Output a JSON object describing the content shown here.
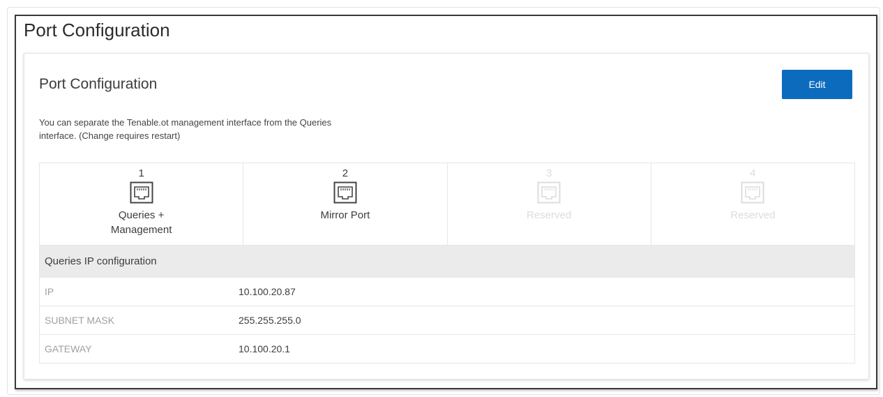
{
  "page": {
    "title": "Port Configuration"
  },
  "card": {
    "title": "Port Configuration",
    "edit_label": "Edit",
    "description_line1": "You can separate the Tenable.ot management interface from the Queries",
    "description_line2": "interface. (Change requires restart)"
  },
  "ports": [
    {
      "number": "1",
      "label_line1": "Queries +",
      "label_line2": "Management",
      "icon": "ethernet-port-icon",
      "enabled": true
    },
    {
      "number": "2",
      "label_line1": "Mirror Port",
      "label_line2": "",
      "icon": "ethernet-port-icon",
      "enabled": true
    },
    {
      "number": "3",
      "label_line1": "Reserved",
      "label_line2": "",
      "icon": "ethernet-port-icon",
      "enabled": false
    },
    {
      "number": "4",
      "label_line1": "Reserved",
      "label_line2": "",
      "icon": "ethernet-port-icon",
      "enabled": false
    }
  ],
  "ip_config": {
    "header": "Queries IP configuration",
    "rows": [
      {
        "key": "IP",
        "value": "10.100.20.87"
      },
      {
        "key": "SUBNET MASK",
        "value": "255.255.255.0"
      },
      {
        "key": "GATEWAY",
        "value": "10.100.20.1"
      }
    ]
  },
  "colors": {
    "accent": "#0d6bbd",
    "section_bg": "#ebebeb",
    "disabled_text": "#dcdcdc"
  }
}
